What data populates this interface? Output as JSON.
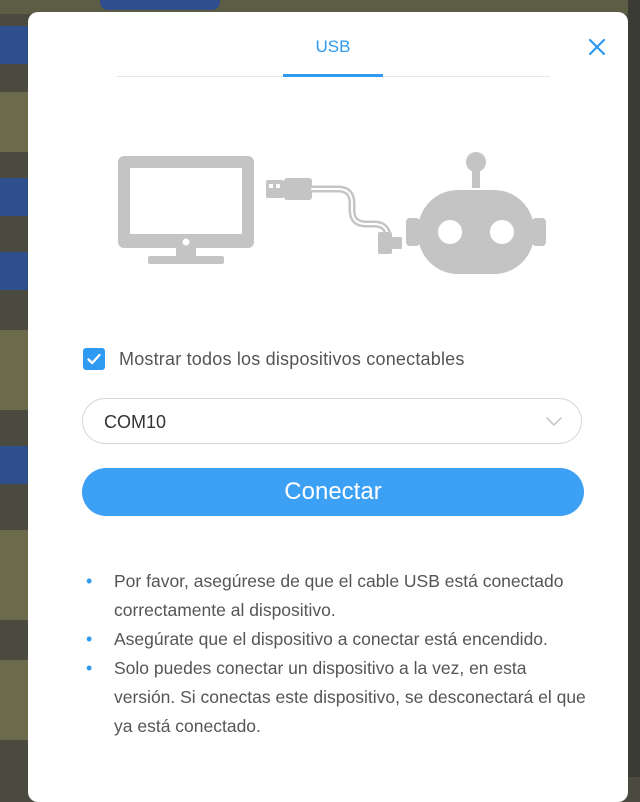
{
  "dialog": {
    "tab_label": "USB",
    "close_icon": "close-icon",
    "show_all_label": "Mostrar todos los dispositivos conectables",
    "show_all_checked": true,
    "port_select": {
      "value": "COM10"
    },
    "connect_label": "Conectar",
    "notes": [
      "Por favor, asegúrese de que el cable USB está conectado correctamente al dispositivo.",
      "Asegúrate que el dispositivo a conectar está encendido.",
      "Solo puedes conectar un dispositivo a la vez, en esta versión. Si conectas este dispositivo, se desconectará el que ya está conectado."
    ]
  },
  "colors": {
    "accent": "#2e9af2",
    "button": "#3ca0f5",
    "illustration": "#c4c4c4",
    "text": "#555555"
  },
  "icons": {
    "illustration": [
      "monitor-icon",
      "usb-cable-icon",
      "robot-icon"
    ],
    "checkbox": "check-icon",
    "select": "chevron-down-icon"
  }
}
